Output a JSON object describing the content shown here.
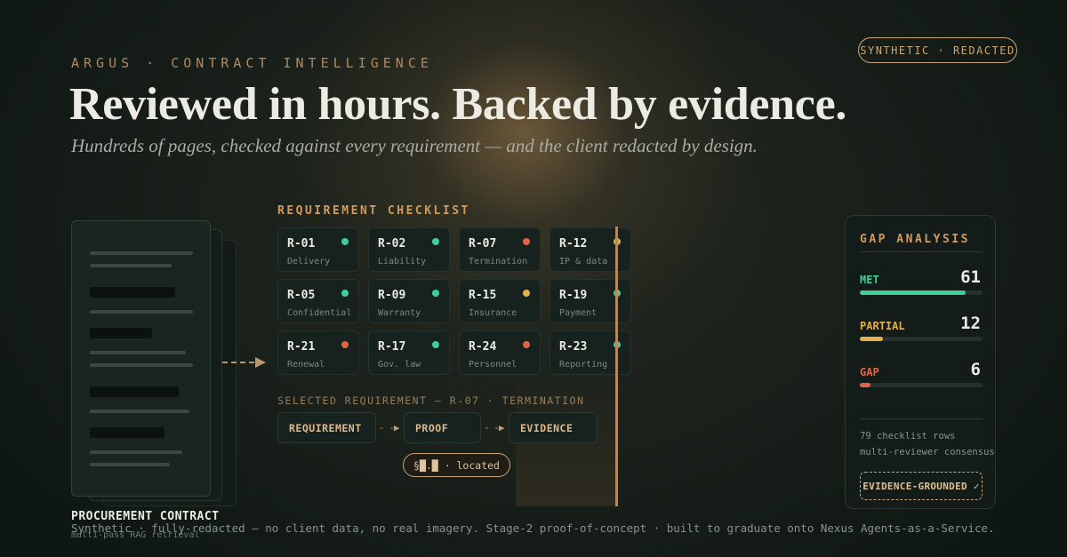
{
  "header": {
    "eyebrow": "ARGUS · CONTRACT INTELLIGENCE",
    "badge": "SYNTHETIC · REDACTED",
    "headline": "Reviewed in hours. Backed by evidence.",
    "subhead": "Hundreds of pages, checked against every requirement — and the client redacted by design."
  },
  "document": {
    "title": "PROCUREMENT CONTRACT",
    "subtitle": "multi-pass RAG retrieval"
  },
  "checklist": {
    "title": "REQUIREMENT CHECKLIST",
    "items": [
      {
        "id": "R-01",
        "name": "Delivery",
        "status": "met"
      },
      {
        "id": "R-02",
        "name": "Liability",
        "status": "met"
      },
      {
        "id": "R-07",
        "name": "Termination",
        "status": "gap"
      },
      {
        "id": "R-12",
        "name": "IP & data",
        "status": "partial"
      },
      {
        "id": "R-05",
        "name": "Confidential",
        "status": "met"
      },
      {
        "id": "R-09",
        "name": "Warranty",
        "status": "met"
      },
      {
        "id": "R-15",
        "name": "Insurance",
        "status": "partial"
      },
      {
        "id": "R-19",
        "name": "Payment",
        "status": "met"
      },
      {
        "id": "R-21",
        "name": "Renewal",
        "status": "gap"
      },
      {
        "id": "R-17",
        "name": "Gov. law",
        "status": "met"
      },
      {
        "id": "R-24",
        "name": "Personnel",
        "status": "gap"
      },
      {
        "id": "R-23",
        "name": "Reporting",
        "status": "met"
      }
    ],
    "status_colors": {
      "met": "#3ecf99",
      "partial": "#e3b04b",
      "gap": "#e0644a"
    }
  },
  "selected": {
    "label": "SELECTED REQUIREMENT — R-07 · TERMINATION",
    "flow": [
      "REQUIREMENT",
      "PROOF",
      "EVIDENCE"
    ],
    "arrow": "- -▶",
    "located": "§█.█ · located"
  },
  "gap_analysis": {
    "title": "GAP ANALYSIS",
    "metrics": [
      {
        "label": "MET",
        "value": "61",
        "fraction": 0.86,
        "color": "#3ecf99"
      },
      {
        "label": "PARTIAL",
        "value": "12",
        "fraction": 0.19,
        "color": "#e3b04b"
      },
      {
        "label": "GAP",
        "value": "6",
        "fraction": 0.09,
        "color": "#e0644a"
      }
    ],
    "note_rows": "79 checklist rows",
    "note_consensus": "multi-reviewer consensus",
    "grounded": "EVIDENCE-GROUNDED ✓"
  },
  "footer": "Synthetic · fully-redacted — no client data, no real imagery.   Stage-2 proof-of-concept · built to graduate onto Nexus Agents-as-a-Service."
}
